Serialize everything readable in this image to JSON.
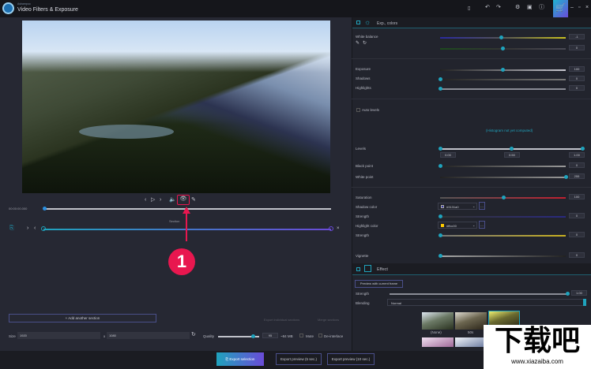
{
  "app": {
    "vendor": "Ashampoo",
    "title": "Video Filters & Exposure"
  },
  "titlebar": {
    "icons": [
      "clipboard-icon",
      "undo-icon",
      "redo-icon",
      "settings-icon",
      "image-icon",
      "info-icon",
      "cart-icon",
      "minimize-icon",
      "restore-icon",
      "close-icon"
    ]
  },
  "player": {
    "timecode": "00:00:00.000",
    "section_label": "Section",
    "annotation_number": "1",
    "accent": "#e8174f"
  },
  "sections": {
    "add_label": "+ Add another section",
    "export_individual": "Export individual sections",
    "merge": "Merge sections"
  },
  "output": {
    "size_label": "Size",
    "width": "1920",
    "x": "x",
    "height": "1080",
    "quality_label": "Quality",
    "quality": "95",
    "size_est": "~84 MB",
    "mute_label": "Mute",
    "deinterlace_label": "De-interlace",
    "quality_fraction": 0.9
  },
  "footer": {
    "export_selection": "Export selection",
    "export_preview_5": "Export preview (5 sec.)",
    "export_preview_10": "Export preview (10 sec.)"
  },
  "colors_panel": {
    "title": "Exp., colors",
    "white_balance": {
      "label": "White balance",
      "value1": "-1",
      "value2": "0",
      "pos1": 0.5,
      "pos2": 0.51
    },
    "exposure": {
      "label": "Exposure",
      "value": "100",
      "pos": 0.51
    },
    "shadows": {
      "label": "Shadows",
      "value": "0",
      "pos": 0
    },
    "highlights": {
      "label": "Highlights",
      "value": "0",
      "pos": 0
    },
    "auto_levels": "Auto levels",
    "histogram_note": "(Histogram not yet computed)",
    "levels": {
      "label": "Levels",
      "low": "0.00",
      "mid": "0.50",
      "high": "1.00"
    },
    "black_point": {
      "label": "Black point",
      "value": "0",
      "pos": 0
    },
    "white_point": {
      "label": "White point",
      "value": "255",
      "pos": 1
    },
    "saturation": {
      "label": "Saturation",
      "value": "100",
      "pos": 0.5
    },
    "shadow_color": {
      "label": "Shadow color",
      "value": "#3131a0",
      "swatch": "#3131a0",
      "more": "..."
    },
    "shadow_strength": {
      "label": "Strength",
      "value": "0",
      "pos": 0
    },
    "highlight_color": {
      "label": "Highlight color",
      "value": "#ffcc00",
      "swatch": "#ffcc00",
      "more": "..."
    },
    "highlight_strength": {
      "label": "Strength",
      "value": "0",
      "pos": 0
    },
    "vignette": {
      "label": "Vignette",
      "value": "0",
      "pos": 0
    }
  },
  "effect_panel": {
    "title": "Effect",
    "preview_button": "Preview with current frame",
    "strength": {
      "label": "Strength",
      "value": "1.00",
      "pos": 1
    },
    "blending": {
      "label": "Blending",
      "value": "Normal"
    },
    "thumbnails": [
      {
        "label": "(None)"
      },
      {
        "label": "50s"
      },
      {
        "label": ""
      }
    ]
  },
  "watermark": {
    "text": "下载吧",
    "url": "www.xiazaiba.com"
  }
}
